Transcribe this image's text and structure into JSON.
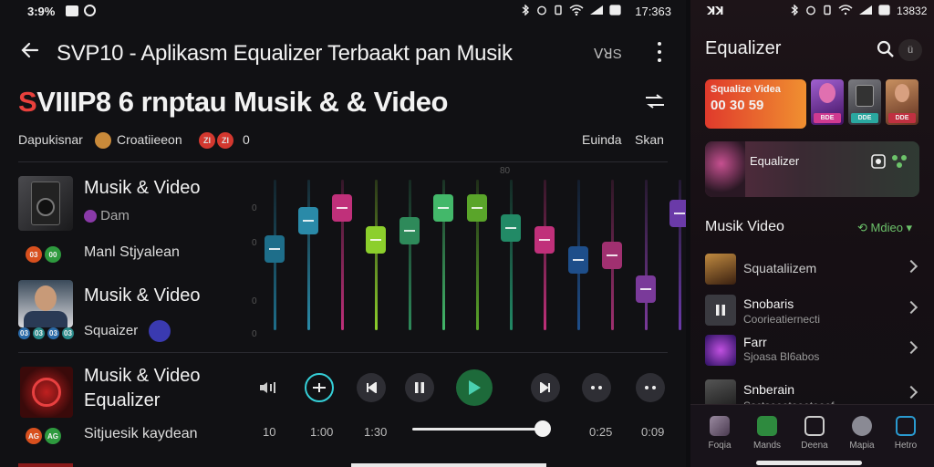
{
  "left_screen": {
    "status": {
      "time": "3:9%",
      "clock": "17:363"
    },
    "app_bar": {
      "title": "SVP10 - Aplikasm Equalizer Terbaakt pan Musik",
      "extra": "ꓦꓤS"
    },
    "hero": {
      "title_red": "S",
      "title_rest": "VIIIP8 6 rnptau Musik & & Video"
    },
    "meta": {
      "left_label": "Dapukisnar",
      "creator": "Croatiieeon",
      "badges": [
        "ZI",
        "ZI"
      ],
      "count": "0",
      "right_label_1": "Euinda",
      "right_label_2": "Skan"
    },
    "list": [
      {
        "title": "Musik & Video",
        "sub": "Dam",
        "extra": "Manl Stjyalean",
        "badges": [
          "03",
          "00"
        ]
      },
      {
        "title": "Musik & Video",
        "sub": "Squaizer",
        "badges": [
          "03",
          "03",
          "03",
          "03"
        ]
      },
      {
        "title_line1": "Musik & Video",
        "title_line2": "Equalizer",
        "sub": "Sitjuesik kaydean",
        "badges": [
          "AG",
          "AG"
        ]
      }
    ],
    "eq_side_marks": [
      "0",
      "0",
      "0",
      "0"
    ],
    "eq_top_mark": "80",
    "eq_bands": [
      {
        "color": "#1e6e8a",
        "level": 0.55
      },
      {
        "color": "#2a8aa8",
        "level": 0.78
      },
      {
        "color": "#c0307a",
        "level": 0.88
      },
      {
        "color": "#8ccf2c",
        "level": 0.62
      },
      {
        "color": "#2e8a5a",
        "level": 0.7
      },
      {
        "color": "#43b86a",
        "level": 0.88
      },
      {
        "color": "#5aa52a",
        "level": 0.88
      },
      {
        "color": "#228a66",
        "level": 0.72
      },
      {
        "color": "#c0307a",
        "level": 0.62
      },
      {
        "color": "#1e4e8a",
        "level": 0.46
      },
      {
        "color": "#a03070",
        "level": 0.5
      },
      {
        "color": "#7a3a9a",
        "level": 0.22
      },
      {
        "color": "#6a3aa8",
        "level": 0.84
      }
    ],
    "player": {
      "times": [
        "10",
        "1:00",
        "1:30",
        "0:25",
        "0:09"
      ],
      "progress": 0.95
    }
  },
  "right_screen": {
    "status": {
      "left": "ꓘꓘ",
      "clock": "13832"
    },
    "title": "Equalizer",
    "search_hint": "ü",
    "banner": {
      "line1": "Squalize Videa",
      "line2": "00 30 59"
    },
    "thumb_labels": [
      "BDE",
      "DDE",
      "DDE"
    ],
    "feature": {
      "label": "Equalizer"
    },
    "section": {
      "title": "Musik Video",
      "action": "Mdieo"
    },
    "rows": [
      {
        "name": "Squataliizem",
        "sub": ""
      },
      {
        "name": "Snobaris",
        "sub": "Coorieatiernecti"
      },
      {
        "name": "Farr",
        "sub": "Sjoasa Bl6abos"
      },
      {
        "name": "Snberain",
        "sub": "Ssctsoeetooetooef"
      }
    ],
    "nav": [
      "Foqia",
      "Mands",
      "Deena",
      "Mapia",
      "Hetro"
    ],
    "colors": {
      "accent": "#6cc36a",
      "brand_red": "#e8403c"
    }
  }
}
